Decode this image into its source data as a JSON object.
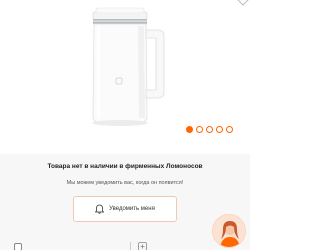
{
  "product": {
    "image_icon": "electric-kettle-image",
    "favorite_icon": "heart-icon"
  },
  "gallery": {
    "total": 5,
    "active": 1
  },
  "availability": {
    "title": "Товара нет в наличии в фирменных Ломоносов",
    "text": "Мы можем уведомить вас, когда он появится!",
    "button_label": "Уведомить меня",
    "button_icon": "bell-icon"
  },
  "bottom": {
    "compare_icon": "checkbox-icon",
    "share_icon": "share-icon",
    "assistant_icon": "chat-assistant-avatar"
  },
  "colors": {
    "accent": "#ff6700",
    "panel_bg": "#f7f7f7",
    "button_border": "#f0c9b0"
  }
}
